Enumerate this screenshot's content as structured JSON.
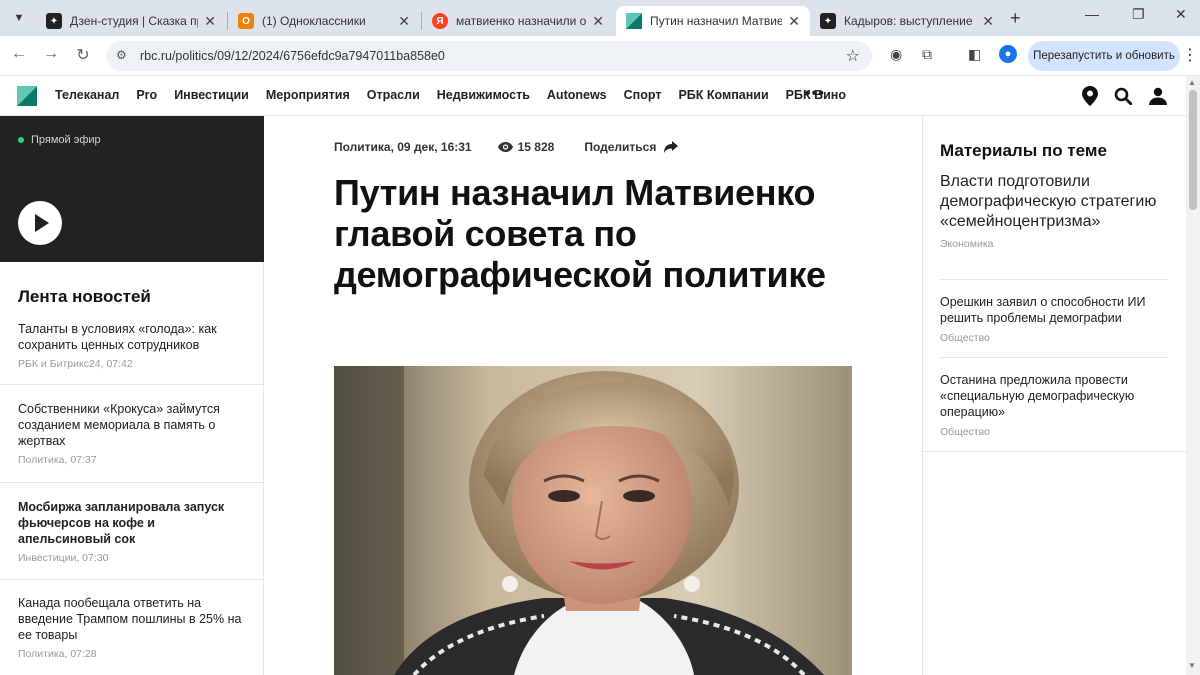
{
  "browser": {
    "tabs": [
      {
        "title": "Дзен-студия | Сказка про р",
        "favicon": "dzen",
        "color": "#222222"
      },
      {
        "title": "(1) Одноклассники",
        "favicon": "ok",
        "color": "#ee8208"
      },
      {
        "title": "матвиенко назначили отве",
        "favicon": "yandex",
        "color": "#fc3f1d"
      },
      {
        "title": "Путин назначил Матвиенко",
        "favicon": "rbc",
        "color": "#0b7a68"
      },
      {
        "title": "Кадыров: выступление Пут",
        "favicon": "dzen",
        "color": "#222222"
      }
    ],
    "url": "rbc.ru/politics/09/12/2024/6756efdc9a7947011ba858e0",
    "relaunch_label": "Перезапустить и обновить"
  },
  "site": {
    "nav": [
      "Телеканал",
      "Pro",
      "Инвестиции",
      "Мероприятия",
      "Отрасли",
      "Недвижимость",
      "Autonews",
      "Спорт",
      "РБК Компании",
      "РБК Вино"
    ],
    "live_label": "Прямой эфир",
    "brand_color": "#0b7a68"
  },
  "feed": {
    "title": "Лента новостей",
    "items": [
      {
        "headline": "Таланты в условиях «голода»: как сохранить ценных сотрудников",
        "meta": "РБК и Битрикс24, 07:42"
      },
      {
        "headline": "Собственники «Крокуса» займутся созданием мемориала в память о жертвах",
        "meta": "Политика, 07:37"
      },
      {
        "headline": "Мосбиржа запланировала запуск фьючерсов на кофе и апельсиновый сок",
        "meta": "Инвестиции, 07:30"
      },
      {
        "headline": "Канада пообещала ответить на введение Трампом пошлины в 25% на ее товары",
        "meta": "Политика, 07:28"
      }
    ]
  },
  "article": {
    "rubric_time": "Политика, 09 дек, 16:31",
    "views": "15 828",
    "share": "Поделиться",
    "headline": "Путин назначил Матвиенко главой совета по демографической политике"
  },
  "related": {
    "title": "Материалы по теме",
    "items": [
      {
        "headline": "Власти подготовили демографическую стратегию «семейноцентризма»",
        "category": "Экономика"
      },
      {
        "headline": "Орешкин заявил о способности ИИ решить проблемы демографии",
        "category": "Общество"
      },
      {
        "headline": "Останина предложила провести «специальную демографическую операцию»",
        "category": "Общество"
      }
    ]
  }
}
